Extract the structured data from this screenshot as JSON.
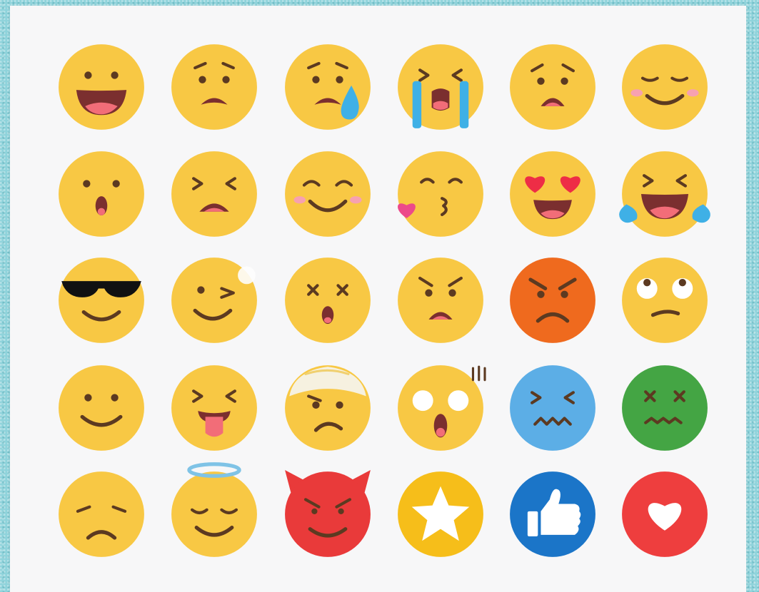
{
  "colors": {
    "background_teal": "#8fd3db",
    "panel": "#f7f7f8",
    "face_yellow": "#f8c844",
    "feature_brown": "#5c3a21",
    "mouth_dark": "#7b2f2f",
    "tongue_pink": "#f26d78",
    "tear_blue": "#3fb0e6",
    "blush_pink": "#f7a1b0",
    "heart_red": "#ee2d46",
    "angry_orange": "#ef6a1e",
    "frozen_blue": "#5caee6",
    "sick_green": "#44a544",
    "devil_red": "#e93a3a",
    "star_gold": "#f6be1a",
    "like_blue": "#1b75c8",
    "love_red": "#ee3e3e",
    "halo": "#7fc3e6",
    "bandage": "#f6f1e0"
  },
  "emojis": [
    {
      "name": "grinning-face-icon"
    },
    {
      "name": "frowning-face-icon"
    },
    {
      "name": "sad-tear-face-icon"
    },
    {
      "name": "loudly-crying-face-icon"
    },
    {
      "name": "worried-face-icon"
    },
    {
      "name": "blushing-smile-face-icon"
    },
    {
      "name": "surprised-face-icon"
    },
    {
      "name": "persevering-face-icon"
    },
    {
      "name": "happy-blush-face-icon"
    },
    {
      "name": "kissing-heart-face-icon"
    },
    {
      "name": "heart-eyes-face-icon"
    },
    {
      "name": "tears-of-joy-face-icon"
    },
    {
      "name": "sunglasses-face-icon"
    },
    {
      "name": "winking-face-icon"
    },
    {
      "name": "dizzy-face-icon"
    },
    {
      "name": "annoyed-face-icon"
    },
    {
      "name": "angry-face-icon"
    },
    {
      "name": "eye-roll-face-icon"
    },
    {
      "name": "slight-smile-face-icon"
    },
    {
      "name": "tongue-out-face-icon"
    },
    {
      "name": "bandaged-head-face-icon"
    },
    {
      "name": "shocked-face-icon"
    },
    {
      "name": "freezing-face-icon"
    },
    {
      "name": "nauseated-face-icon"
    },
    {
      "name": "pensive-face-icon"
    },
    {
      "name": "angel-halo-face-icon"
    },
    {
      "name": "devil-face-icon"
    },
    {
      "name": "star-icon"
    },
    {
      "name": "thumbs-up-icon"
    },
    {
      "name": "heart-icon"
    }
  ]
}
